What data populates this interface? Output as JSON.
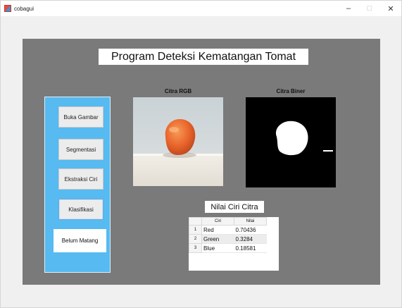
{
  "window": {
    "title": "cobagui",
    "controls": [
      "–",
      "□",
      "✕"
    ]
  },
  "app": {
    "title": "Program Deteksi Kematangan Tomat"
  },
  "buttons": {
    "open_image": "Buka Gambar",
    "segmentation": "Segmentasi",
    "feature_extraction": "Ekstraksi Ciri",
    "classification": "Klasifikasi"
  },
  "result": {
    "label": "Belum Matang"
  },
  "images": {
    "rgb_title": "Citra RGB",
    "binary_title": "Citra Biner"
  },
  "feature_table": {
    "title": "Nilai Ciri Citra",
    "columns": [
      "Ciri",
      "Nilai"
    ],
    "rows": [
      {
        "index": "1",
        "ciri": "Red",
        "nilai": "0.70436"
      },
      {
        "index": "2",
        "ciri": "Green",
        "nilai": "0.3284"
      },
      {
        "index": "3",
        "ciri": "Blue",
        "nilai": "0.18581"
      }
    ]
  },
  "colors": {
    "panel": "#7a7a7a",
    "sidebar": "#57baf0",
    "tomato": "#e8622a"
  }
}
